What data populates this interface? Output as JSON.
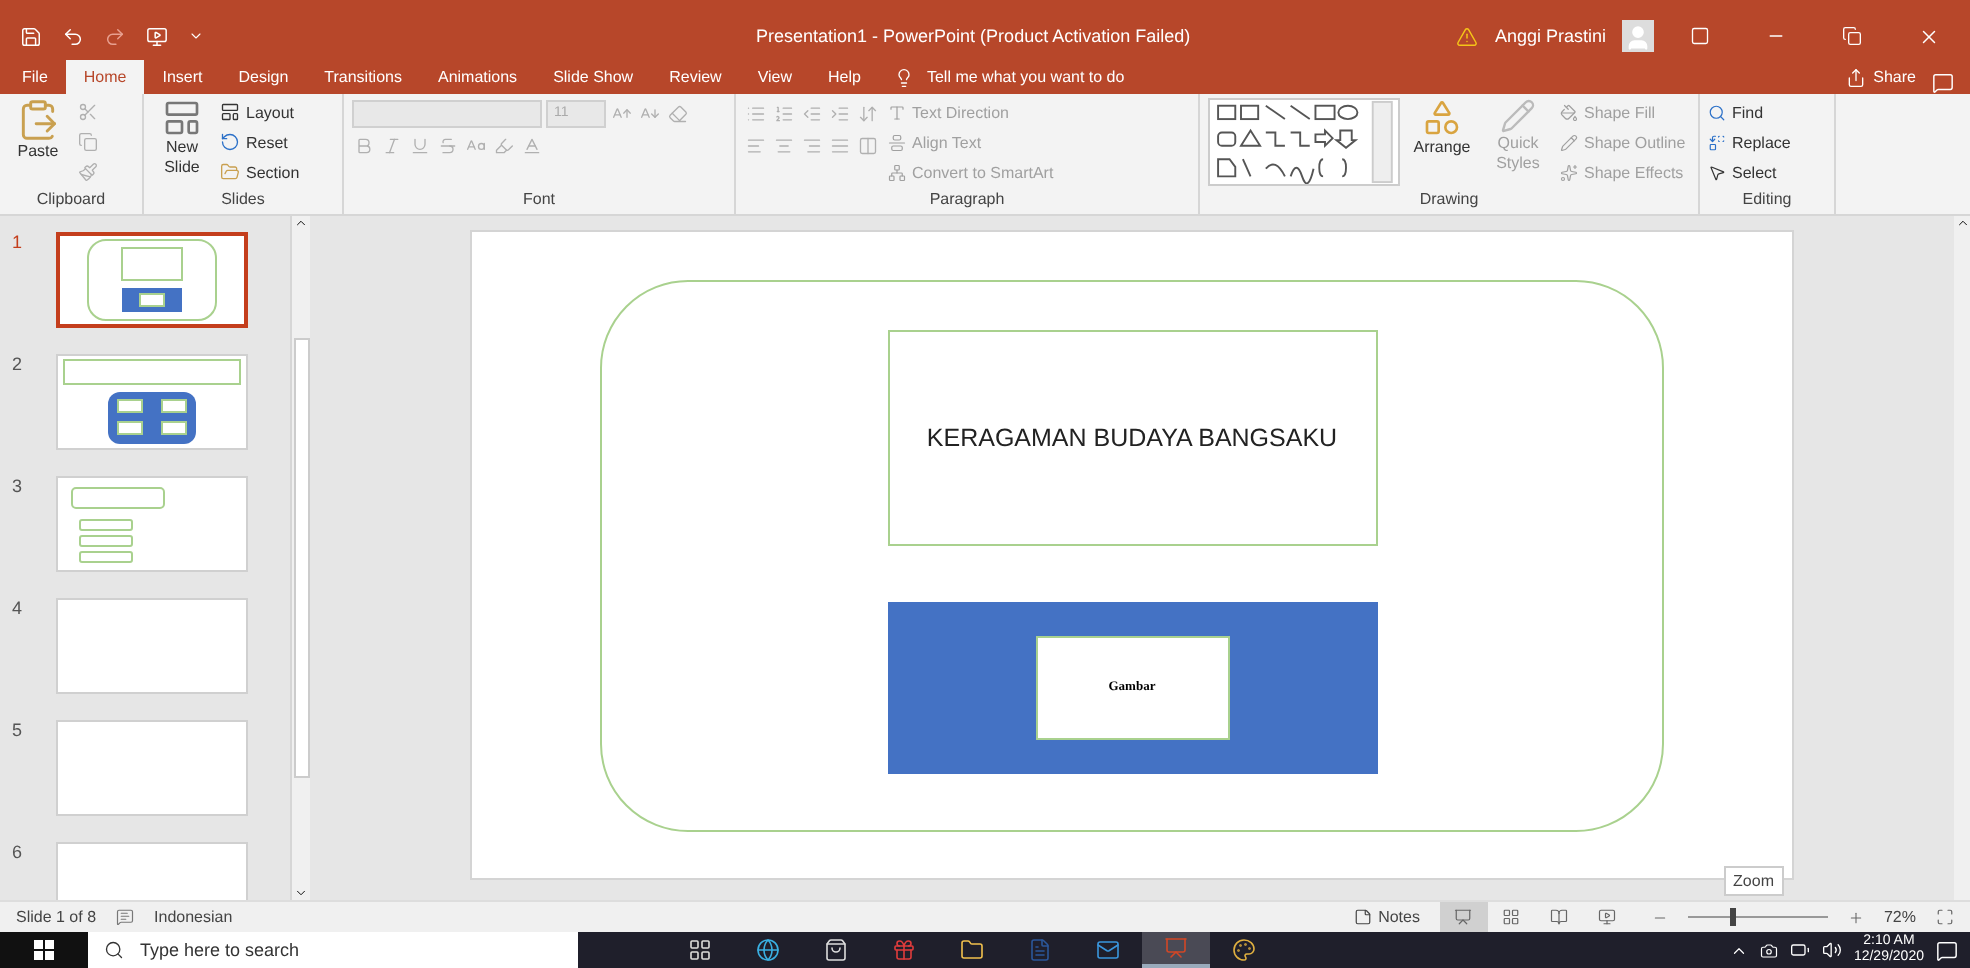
{
  "window": {
    "title": "Presentation1  -  PowerPoint (Product Activation Failed)",
    "user": "Anggi Prastini"
  },
  "tabs": [
    {
      "label": "File",
      "selected": false
    },
    {
      "label": "Home",
      "selected": true
    },
    {
      "label": "Insert",
      "selected": false
    },
    {
      "label": "Design",
      "selected": false
    },
    {
      "label": "Transitions",
      "selected": false
    },
    {
      "label": "Animations",
      "selected": false
    },
    {
      "label": "Slide Show",
      "selected": false
    },
    {
      "label": "Review",
      "selected": false
    },
    {
      "label": "View",
      "selected": false
    },
    {
      "label": "Help",
      "selected": false
    }
  ],
  "tell_me": {
    "placeholder": "Tell me what you want to do"
  },
  "share": "Share",
  "ribbon": {
    "clipboard": {
      "label": "Clipboard",
      "paste": "Paste"
    },
    "slides": {
      "label": "Slides",
      "new_slide": "New Slide",
      "layout": "Layout",
      "reset": "Reset",
      "section": "Section"
    },
    "font": {
      "label": "Font",
      "size": "11",
      "disabled": true
    },
    "paragraph": {
      "label": "Paragraph",
      "text_direction": "Text Direction",
      "align_text": "Align Text",
      "convert": "Convert to SmartArt",
      "disabled": true
    },
    "drawing": {
      "label": "Drawing",
      "arrange": "Arrange",
      "quick_styles": "Quick Styles",
      "shape_fill": "Shape Fill",
      "shape_outline": "Shape Outline",
      "shape_effects": "Shape Effects",
      "styles_disabled": true
    },
    "editing": {
      "label": "Editing",
      "find": "Find",
      "replace": "Replace",
      "select": "Select"
    }
  },
  "slides": [
    {
      "number": "1",
      "selected": true,
      "kind": "title"
    },
    {
      "number": "2",
      "selected": false,
      "kind": "grid"
    },
    {
      "number": "3",
      "selected": false,
      "kind": "list"
    },
    {
      "number": "4",
      "selected": false,
      "kind": "blank"
    },
    {
      "number": "5",
      "selected": false,
      "kind": "blank"
    },
    {
      "number": "6",
      "selected": false,
      "kind": "blank"
    }
  ],
  "slide": {
    "title": "KERAGAMAN BUDAYA BANGSAKU",
    "picture_label": "Gambar"
  },
  "tooltip": "Zoom",
  "status_bar": {
    "slide": "Slide 1 of 8",
    "language": "Indonesian",
    "notes": "Notes",
    "views": [
      {
        "kind": "normal",
        "selected": true
      },
      {
        "kind": "sorter",
        "selected": false
      },
      {
        "kind": "reading",
        "selected": false
      },
      {
        "kind": "show",
        "selected": false
      }
    ],
    "zoom": {
      "level": 0.3,
      "reading": "72%"
    }
  },
  "taskbar": {
    "search": {
      "placeholder": "Type here to search"
    },
    "apps": [
      {
        "selected": false
      },
      {
        "selected": false
      },
      {
        "selected": false
      },
      {
        "selected": false
      },
      {
        "selected": false
      },
      {
        "selected": false
      },
      {
        "selected": false
      },
      {
        "selected": true
      },
      {
        "selected": false
      }
    ],
    "time": "2:10 AM",
    "date": "12/29/2020"
  }
}
